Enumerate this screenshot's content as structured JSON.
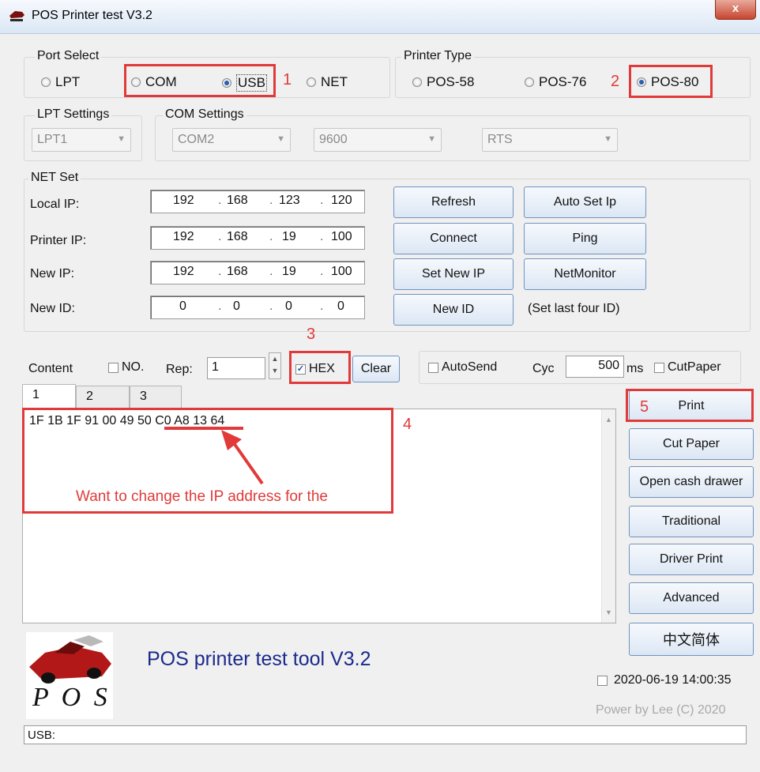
{
  "window": {
    "title": "POS Printer test V3.2",
    "close_label": "x"
  },
  "port_select": {
    "label": "Port Select",
    "options": [
      {
        "label": "LPT",
        "selected": false
      },
      {
        "label": "COM",
        "selected": false
      },
      {
        "label": "USB",
        "selected": true
      },
      {
        "label": "NET",
        "selected": false
      }
    ]
  },
  "printer_type": {
    "label": "Printer Type",
    "options": [
      {
        "label": "POS-58",
        "selected": false
      },
      {
        "label": "POS-76",
        "selected": false
      },
      {
        "label": "POS-80",
        "selected": true
      }
    ]
  },
  "lpt_settings": {
    "label": "LPT Settings",
    "value": "LPT1"
  },
  "com_settings": {
    "label": "COM Settings",
    "port": "COM2",
    "baud": "9600",
    "flow": "RTS"
  },
  "net_set": {
    "label": "NET Set",
    "rows": [
      {
        "label": "Local IP:",
        "octets": [
          "192",
          "168",
          "123",
          "120"
        ]
      },
      {
        "label": "Printer IP:",
        "octets": [
          "192",
          "168",
          "19",
          "100"
        ]
      },
      {
        "label": "New IP:",
        "octets": [
          "192",
          "168",
          "19",
          "100"
        ]
      },
      {
        "label": "New ID:",
        "octets": [
          "0",
          "0",
          "0",
          "0"
        ]
      }
    ],
    "buttons": {
      "refresh": "Refresh",
      "auto_set_ip": "Auto Set Ip",
      "connect": "Connect",
      "ping": "Ping",
      "set_new_ip": "Set New IP",
      "net_monitor": "NetMonitor",
      "new_id": "New ID"
    },
    "hint": "(Set last four ID)"
  },
  "content_bar": {
    "content_label": "Content",
    "no_label": "NO.",
    "no_checked": false,
    "rep_label": "Rep:",
    "rep_value": "1",
    "hex_label": "HEX",
    "hex_checked": true,
    "clear_label": "Clear",
    "autosend_label": "AutoSend",
    "autosend_checked": false,
    "cyc_label": "Cyc",
    "cyc_value": "500",
    "ms_label": "ms",
    "cutpaper_label": "CutPaper",
    "cutpaper_checked": false
  },
  "tabs": [
    "1",
    "2",
    "3"
  ],
  "editor": {
    "content": "1F 1B 1F 91 00 49 50 C0 A8 13 64"
  },
  "side_buttons": {
    "print": "Print",
    "cut_paper": "Cut Paper",
    "open_cash_drawer": "Open cash drawer",
    "traditional": "Traditional",
    "driver_print": "Driver Print",
    "advanced": "Advanced",
    "chinese": "中文简体"
  },
  "footer": {
    "logo_text": "P O S",
    "tool_title": "POS printer test tool V3.2",
    "datetime": "2020-06-19 14:00:35",
    "datetime_checked": false,
    "credit": "Power by Lee (C) 2020",
    "status": "USB:"
  },
  "annotations": {
    "step1": "1",
    "step2": "2",
    "step3": "3",
    "step4": "4",
    "step5": "5",
    "note": "Want to change the IP address for the"
  },
  "colors": {
    "annotation_red": "#e03a3a",
    "title_blue": "#1a2a8c",
    "button_border": "#6f93c0"
  }
}
